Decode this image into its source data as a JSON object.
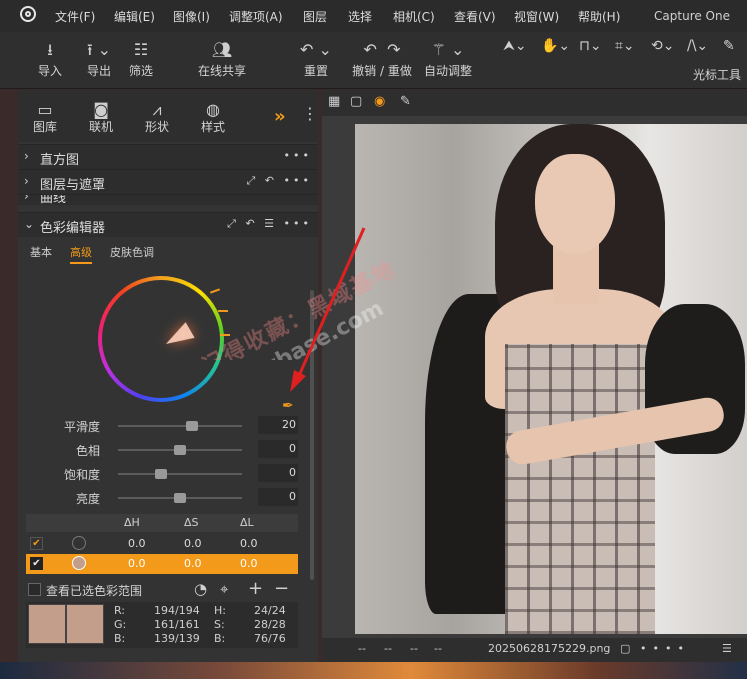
{
  "menubar": {
    "items": [
      "文件(F)",
      "编辑(E)",
      "图像(I)",
      "调整项(A)",
      "图层",
      "选择",
      "相机(C)",
      "查看(V)",
      "视窗(W)",
      "帮助(H)"
    ],
    "app_name": "Capture One"
  },
  "toolbar": {
    "import": "导入",
    "export": "导出",
    "filter": "筛选",
    "share": "在线共享",
    "reset": "重置",
    "undo_redo": "撤销 / 重做",
    "auto_adjust": "自动调整",
    "cursor_tools": "光标工具"
  },
  "tooltabs": {
    "library": "图库",
    "tether": "联机",
    "shape": "形状",
    "style": "样式"
  },
  "sections": {
    "histogram": "直方图",
    "layers": "图层与遮罩",
    "curve": "曲线",
    "color_editor": "色彩编辑器"
  },
  "subtabs": {
    "basic": "基本",
    "advanced": "高级",
    "skin": "皮肤色调"
  },
  "sliders": [
    {
      "label": "平滑度",
      "value": "20",
      "fraction": 0.6
    },
    {
      "label": "色相",
      "value": "0",
      "fraction": 0.5
    },
    {
      "label": "饱和度",
      "value": "0",
      "fraction": 0.35
    },
    {
      "label": "亮度",
      "value": "0",
      "fraction": 0.5
    }
  ],
  "delta_headers": {
    "h": "ΔH",
    "s": "ΔS",
    "l": "ΔL"
  },
  "delta_rows": [
    {
      "h": "0.0",
      "s": "0.0",
      "l": "0.0"
    },
    {
      "h": "0.0",
      "s": "0.0",
      "l": "0.0"
    }
  ],
  "view_selected": "查看已选色彩范围",
  "info": {
    "r_label": "R:",
    "r_value": "194/194",
    "g_label": "G:",
    "g_value": "161/161",
    "b_label": "B:",
    "b_value": "139/139",
    "h_label": "H:",
    "h_value": "24/24",
    "s_label": "S:",
    "s_value": "28/28",
    "bl_label": "B:",
    "bl_value": "76/76"
  },
  "status": {
    "dashes": [
      "--",
      "--",
      "--",
      "--"
    ],
    "filename": "20250628175229.png"
  },
  "watermark": {
    "cn": "记得收藏：黑域基地",
    "en": "Hybase.com"
  },
  "colors": {
    "accent": "#f39a1a",
    "swatch": "#c29e8b",
    "panel": "#333333",
    "arrow": "#e02020"
  }
}
